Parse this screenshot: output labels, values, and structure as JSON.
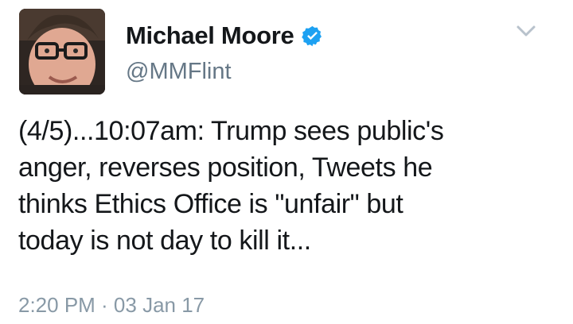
{
  "author": {
    "display_name": "Michael Moore",
    "handle": "@MMFlint",
    "verified": true,
    "avatar_icon": "profile-photo"
  },
  "tweet": {
    "lines": [
      "(4/5)...10:07am: Trump sees public's",
      "anger, reverses position, Tweets he",
      "thinks Ethics Office is \"unfair\" but",
      "today is not day to kill it..."
    ],
    "timestamp": "2:20 PM · 03 Jan 17"
  },
  "icons": {
    "verified": "verified-badge-icon",
    "menu": "chevron-down-icon"
  },
  "colors": {
    "verified_blue": "#1da1f2",
    "secondary_text": "#657786",
    "timestamp_text": "#8899a6",
    "primary_text": "#14171a"
  }
}
